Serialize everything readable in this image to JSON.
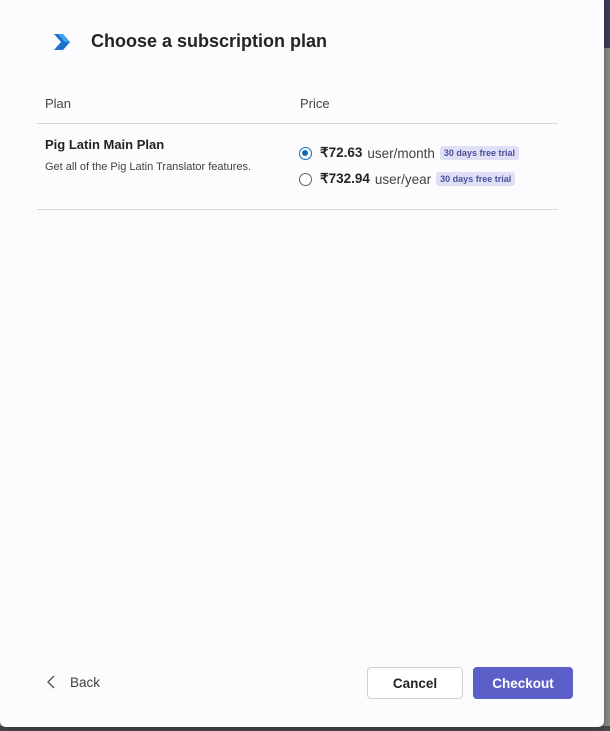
{
  "dialog": {
    "title": "Choose a subscription plan"
  },
  "table": {
    "headers": {
      "plan": "Plan",
      "price": "Price"
    },
    "plan": {
      "name": "Pig Latin Main Plan",
      "description": "Get all of the Pig Latin Translator features.",
      "options": [
        {
          "amount": "₹72.63",
          "unit": "user/month",
          "badge": "30 days free trial",
          "selected": true
        },
        {
          "amount": "₹732.94",
          "unit": "user/year",
          "badge": "30 days free trial",
          "selected": false
        }
      ]
    }
  },
  "footer": {
    "back_label": "Back",
    "cancel_label": "Cancel",
    "checkout_label": "Checkout"
  },
  "colors": {
    "accent": "#5b5fc7",
    "radio_selected": "#0f6cbd",
    "badge_bg": "#dfe0f5",
    "badge_text": "#4b4f9e"
  },
  "icons": {
    "app": "chevron-arrow-logo-icon",
    "back": "chevron-left-icon"
  }
}
